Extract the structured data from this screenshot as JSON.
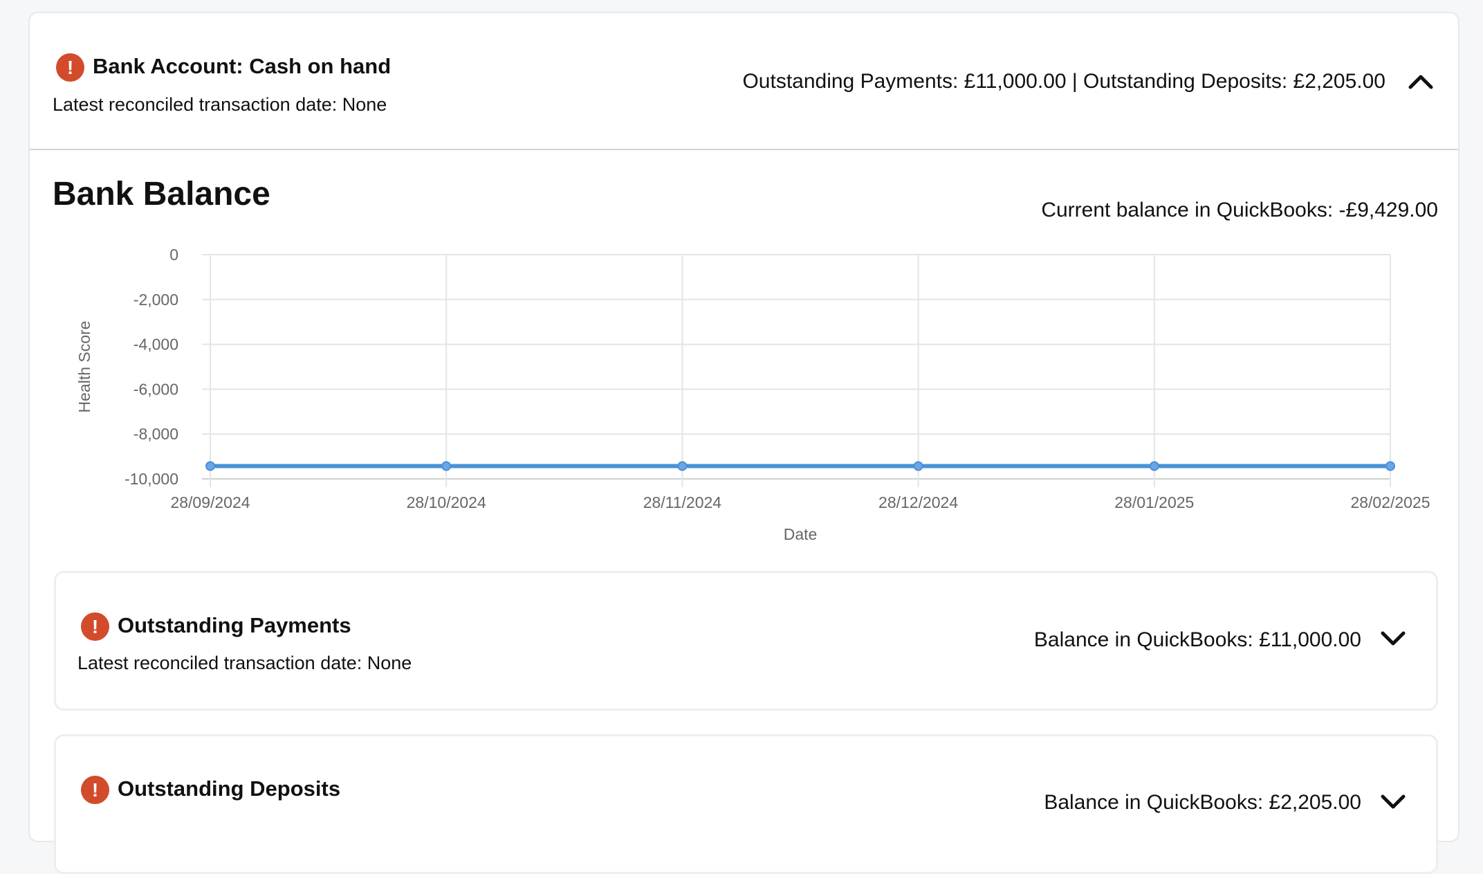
{
  "account": {
    "title": "Bank Account: Cash on hand",
    "reconciled": "Latest reconciled transaction date: None",
    "summary": "Outstanding Payments: £11,000.00 | Outstanding Deposits: £2,205.00"
  },
  "balance_section": {
    "heading": "Bank Balance",
    "current_balance": "Current balance in QuickBooks: -£9,429.00"
  },
  "chart_data": {
    "type": "line",
    "xlabel": "Date",
    "ylabel": "Health Score",
    "x": [
      "28/09/2024",
      "28/10/2024",
      "28/11/2024",
      "28/12/2024",
      "28/01/2025",
      "28/02/2025"
    ],
    "series": [
      {
        "values": [
          -9429,
          -9429,
          -9429,
          -9429,
          -9429,
          -9429
        ],
        "color": "#4a90d9"
      }
    ],
    "ylim": [
      -10000,
      0
    ],
    "yticks": [
      0,
      -2000,
      -4000,
      -6000,
      -8000,
      -10000
    ],
    "ytick_labels": [
      "0",
      "-2,000",
      "-4,000",
      "-6,000",
      "-8,000",
      "-10,000"
    ],
    "grid": true
  },
  "outstanding_payments": {
    "title": "Outstanding Payments",
    "reconciled": "Latest reconciled transaction date: None",
    "balance": "Balance in QuickBooks: £11,000.00"
  },
  "outstanding_deposits": {
    "title": "Outstanding Deposits",
    "balance": "Balance in QuickBooks: £2,205.00"
  },
  "colors": {
    "alert": "#d24b2b",
    "line": "#4a90d9"
  }
}
